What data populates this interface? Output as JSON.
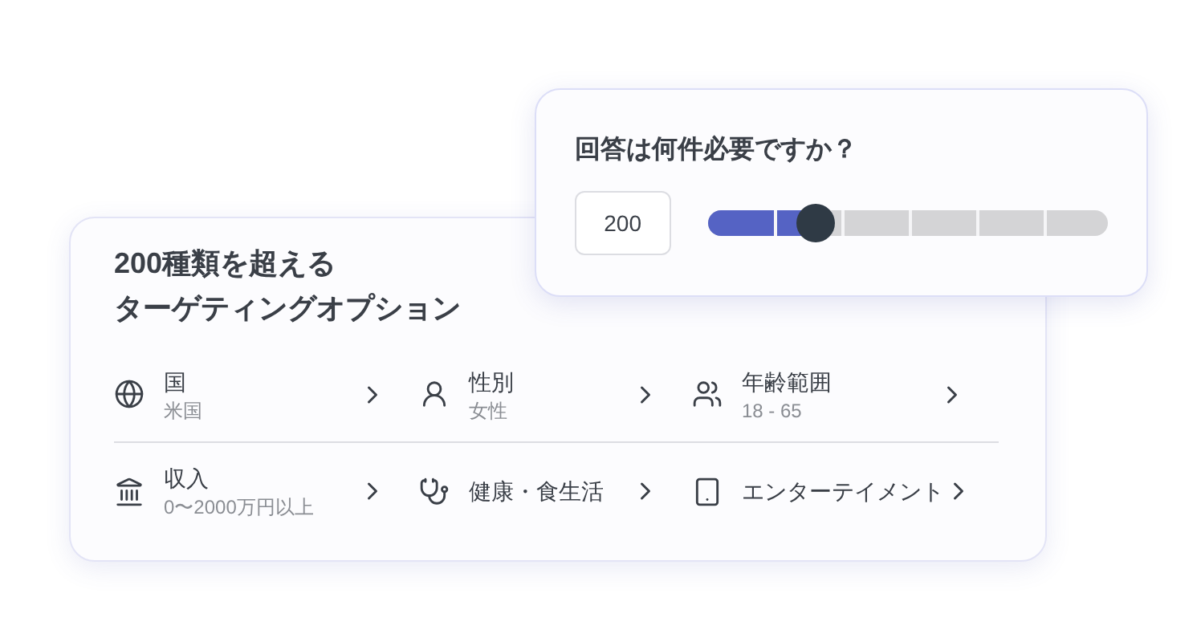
{
  "targeting_card": {
    "title_lines": [
      "200種類を超える",
      "ターゲティングオプション"
    ],
    "rows": [
      [
        {
          "label": "国",
          "value": "米国"
        },
        {
          "label": "性別",
          "value": "女性"
        },
        {
          "label": "年齢範囲",
          "value": "18 - 65"
        }
      ],
      [
        {
          "label": "収入",
          "value": "0〜2000万円以上"
        },
        {
          "label": "健康・食生活"
        },
        {
          "label": "エンターテイメント"
        }
      ]
    ]
  },
  "responses_card": {
    "question": "回答は何件必要ですか？",
    "count": "200",
    "slider": {
      "level": 0.27
    }
  }
}
